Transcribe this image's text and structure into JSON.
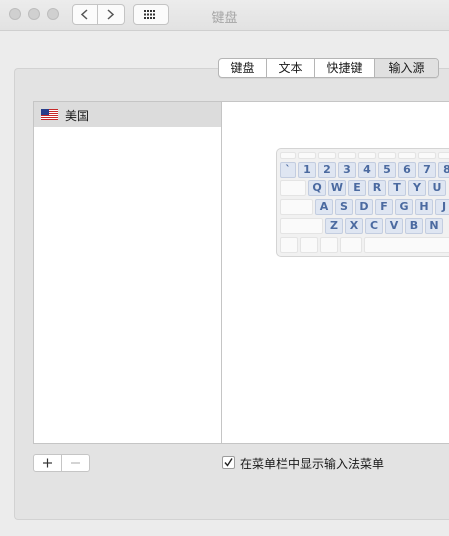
{
  "window": {
    "title": "键盘"
  },
  "tabs": [
    {
      "label": "键盘",
      "active": false
    },
    {
      "label": "文本",
      "active": false
    },
    {
      "label": "快捷键",
      "active": false
    },
    {
      "label": "输入源",
      "active": true
    }
  ],
  "input_sources": [
    {
      "label": "美国",
      "icon": "us-flag-icon",
      "selected": true
    }
  ],
  "keyboard_preview": {
    "row1": [
      "`",
      "1",
      "2",
      "3",
      "4",
      "5",
      "6",
      "7",
      "8"
    ],
    "row2": [
      "Q",
      "W",
      "E",
      "R",
      "T",
      "Y",
      "U"
    ],
    "row3": [
      "A",
      "S",
      "D",
      "F",
      "G",
      "H",
      "J"
    ],
    "row4": [
      "Z",
      "X",
      "C",
      "V",
      "B",
      "N"
    ]
  },
  "controls": {
    "add": "+",
    "remove": "−",
    "show_menu_checkbox": {
      "label": "在菜单栏中显示输入法菜单",
      "checked": true
    }
  },
  "colors": {
    "key_highlight": "#dfe6f2",
    "key_text": "#4b6aa0",
    "selected_row": "#dcdcdc"
  }
}
